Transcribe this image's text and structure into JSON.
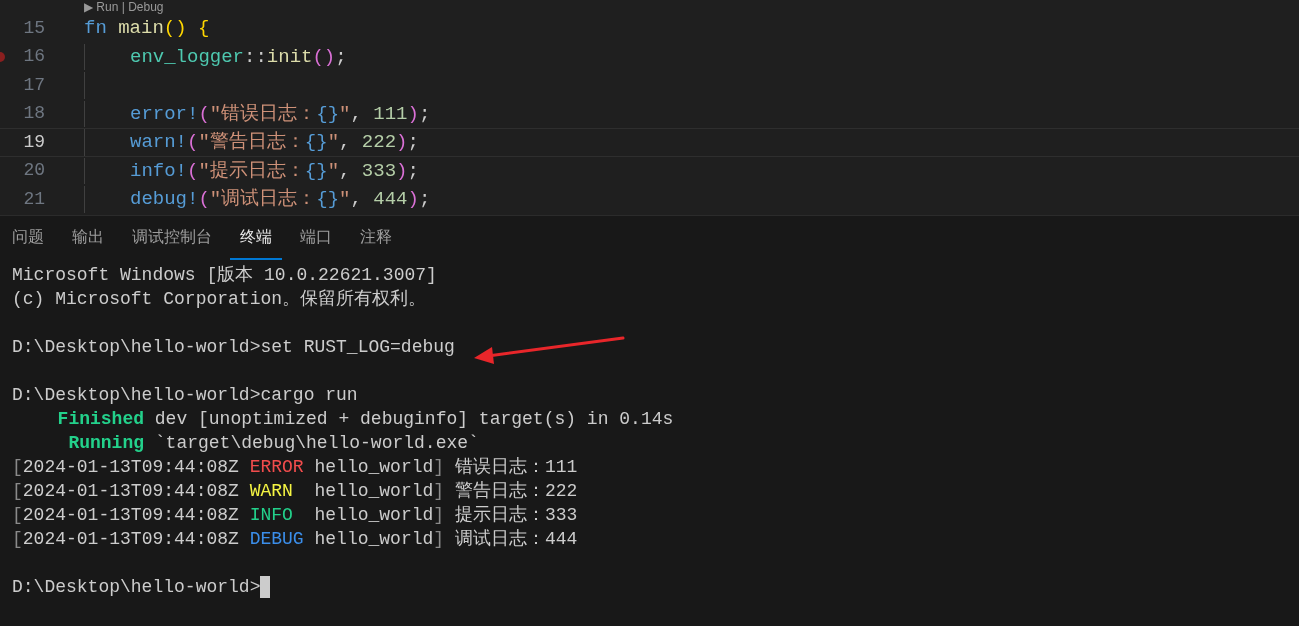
{
  "editor": {
    "codelens": "▶ Run | Debug",
    "lines": [
      {
        "number": "15",
        "current": false,
        "breakpoint": false,
        "indented": false,
        "tokens": [
          {
            "kind": "keyword",
            "text": "fn "
          },
          {
            "kind": "function",
            "text": "main"
          },
          {
            "kind": "paren",
            "text": "() {"
          }
        ]
      },
      {
        "number": "16",
        "current": false,
        "breakpoint": true,
        "indented": true,
        "tokens": [
          {
            "kind": "module",
            "text": "env_logger"
          },
          {
            "kind": "plain",
            "text": "::"
          },
          {
            "kind": "function",
            "text": "init"
          },
          {
            "kind": "paren2",
            "text": "()"
          },
          {
            "kind": "plain",
            "text": ";"
          }
        ]
      },
      {
        "number": "17",
        "current": false,
        "breakpoint": false,
        "indented": true
      },
      {
        "number": "18",
        "current": false,
        "breakpoint": false,
        "indented": true,
        "tokens": [
          {
            "kind": "macro",
            "text": "error!"
          },
          {
            "kind": "paren2",
            "text": "("
          },
          {
            "kind": "string",
            "text": "\"错误日志："
          },
          {
            "kind": "brace",
            "text": "{}"
          },
          {
            "kind": "string",
            "text": "\""
          },
          {
            "kind": "plain",
            "text": ", "
          },
          {
            "kind": "number",
            "text": "111"
          },
          {
            "kind": "paren2",
            "text": ")"
          },
          {
            "kind": "plain",
            "text": ";"
          }
        ]
      },
      {
        "number": "19",
        "current": true,
        "breakpoint": false,
        "indented": true,
        "tokens": [
          {
            "kind": "macro",
            "text": "warn!"
          },
          {
            "kind": "paren2",
            "text": "("
          },
          {
            "kind": "string",
            "text": "\"警告日志："
          },
          {
            "kind": "brace",
            "text": "{}"
          },
          {
            "kind": "string",
            "text": "\""
          },
          {
            "kind": "plain",
            "text": ", "
          },
          {
            "kind": "number",
            "text": "222"
          },
          {
            "kind": "paren2",
            "text": ")"
          },
          {
            "kind": "plain",
            "text": ";"
          }
        ]
      },
      {
        "number": "20",
        "current": false,
        "breakpoint": false,
        "indented": true,
        "tokens": [
          {
            "kind": "macro",
            "text": "info!"
          },
          {
            "kind": "paren2",
            "text": "("
          },
          {
            "kind": "string",
            "text": "\"提示日志："
          },
          {
            "kind": "brace",
            "text": "{}"
          },
          {
            "kind": "string",
            "text": "\""
          },
          {
            "kind": "plain",
            "text": ", "
          },
          {
            "kind": "number",
            "text": "333"
          },
          {
            "kind": "paren2",
            "text": ")"
          },
          {
            "kind": "plain",
            "text": ";"
          }
        ]
      },
      {
        "number": "21",
        "current": false,
        "breakpoint": false,
        "indented": true,
        "tokens": [
          {
            "kind": "macro",
            "text": "debug!"
          },
          {
            "kind": "paren2",
            "text": "("
          },
          {
            "kind": "string",
            "text": "\"调试日志："
          },
          {
            "kind": "brace",
            "text": "{}"
          },
          {
            "kind": "string",
            "text": "\""
          },
          {
            "kind": "plain",
            "text": ", "
          },
          {
            "kind": "number",
            "text": "444"
          },
          {
            "kind": "paren2",
            "text": ")"
          },
          {
            "kind": "plain",
            "text": ";"
          }
        ]
      }
    ]
  },
  "panel_tabs": [
    {
      "label": "问题",
      "selected": false
    },
    {
      "label": "输出",
      "selected": false
    },
    {
      "label": "调试控制台",
      "selected": false
    },
    {
      "label": "终端",
      "selected": true
    },
    {
      "label": "端口",
      "selected": false
    },
    {
      "label": "注释",
      "selected": false
    }
  ],
  "terminal": {
    "lines": [
      {
        "kind": "text",
        "segments": [
          {
            "kind": "plain",
            "text": "Microsoft Windows [版本 10.0.22621.3007]"
          }
        ]
      },
      {
        "kind": "text",
        "segments": [
          {
            "kind": "plain",
            "text": "(c) Microsoft Corporation。保留所有权利。"
          }
        ]
      },
      {
        "kind": "blank"
      },
      {
        "kind": "text",
        "segments": [
          {
            "kind": "plain",
            "text": "D:\\Desktop\\hello-world>set RUST_LOG=debug"
          }
        ]
      },
      {
        "kind": "blank"
      },
      {
        "kind": "text",
        "segments": [
          {
            "kind": "plain",
            "text": "D:\\Desktop\\hello-world>cargo run"
          }
        ]
      },
      {
        "kind": "text",
        "segments": [
          {
            "kind": "status",
            "text": "Finished"
          },
          {
            "kind": "plain",
            "text": " dev [unoptimized + debuginfo] target(s) in 0.14s"
          }
        ]
      },
      {
        "kind": "text",
        "segments": [
          {
            "kind": "status",
            "text": "Running"
          },
          {
            "kind": "plain",
            "text": " `target\\debug\\hello-world.exe`"
          }
        ]
      },
      {
        "kind": "text",
        "segments": [
          {
            "kind": "dim",
            "text": "["
          },
          {
            "kind": "plain",
            "text": "2024-01-13T09:44:08Z "
          },
          {
            "kind": "error",
            "text": "ERROR"
          },
          {
            "kind": "plain",
            "text": " hello_world"
          },
          {
            "kind": "dim",
            "text": "]"
          },
          {
            "kind": "plain",
            "text": " 错误日志：111"
          }
        ]
      },
      {
        "kind": "text",
        "segments": [
          {
            "kind": "dim",
            "text": "["
          },
          {
            "kind": "plain",
            "text": "2024-01-13T09:44:08Z "
          },
          {
            "kind": "warn",
            "text": "WARN"
          },
          {
            "kind": "plain",
            "text": "  hello_world"
          },
          {
            "kind": "dim",
            "text": "]"
          },
          {
            "kind": "plain",
            "text": " 警告日志：222"
          }
        ]
      },
      {
        "kind": "text",
        "segments": [
          {
            "kind": "dim",
            "text": "["
          },
          {
            "kind": "plain",
            "text": "2024-01-13T09:44:08Z "
          },
          {
            "kind": "info",
            "text": "INFO"
          },
          {
            "kind": "plain",
            "text": "  hello_world"
          },
          {
            "kind": "dim",
            "text": "]"
          },
          {
            "kind": "plain",
            "text": " 提示日志：333"
          }
        ]
      },
      {
        "kind": "text",
        "segments": [
          {
            "kind": "dim",
            "text": "["
          },
          {
            "kind": "plain",
            "text": "2024-01-13T09:44:08Z "
          },
          {
            "kind": "debug",
            "text": "DEBUG"
          },
          {
            "kind": "plain",
            "text": " hello_world"
          },
          {
            "kind": "dim",
            "text": "]"
          },
          {
            "kind": "plain",
            "text": " 调试日志：444"
          }
        ]
      },
      {
        "kind": "blank"
      },
      {
        "kind": "text",
        "cursor": true,
        "segments": [
          {
            "kind": "plain",
            "text": "D:\\Desktop\\hello-world>"
          }
        ]
      }
    ]
  }
}
